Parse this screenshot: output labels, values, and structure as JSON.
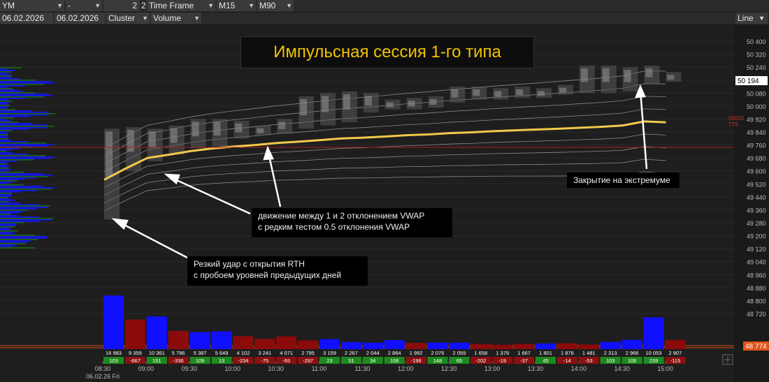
{
  "toolbar": {
    "symbol": "YM",
    "field2": "-",
    "field3": "2",
    "field3b": "2",
    "timeframe_label": "Time Frame",
    "tf1": "M15",
    "tf2": "M90",
    "date_from": "06.02.2026",
    "date_to": "06.02.2026",
    "chart_mode": "Cluster",
    "cluster_value": "Volume",
    "line_button": "Line"
  },
  "title": "Импульсная сессия 1-го типа",
  "callouts": {
    "extreme_close": "Закрытие на экстремуме",
    "vwap_line1": "движение между 1 и 2 отклонением VWAP",
    "vwap_line2": "с редким тестом 0.5 отклонения VWAP",
    "open_line1": "Резкий удар с открытия RTH",
    "open_line2": "с пробоем уровней предыдущих дней"
  },
  "price_badges": {
    "current_price": "50 194",
    "lower_price": "48 774",
    "mid_marker_top": "50000",
    "mid_marker_bottom": "779"
  },
  "colors": {
    "background": "#1c1c1c",
    "vwap": "#f2c94c",
    "buy": "#1010ff",
    "sell": "#8b0a0a",
    "delta_pos": "#1e8a1e",
    "delta_neg": "#8b1010",
    "title_text": "#f2c200",
    "current_badge": "#ffffff",
    "lower_badge": "#e0541a"
  },
  "chart_data": {
    "type": "bar",
    "title": "Импульсная сессия 1-го типа",
    "date_label": "06.02.26 Fri",
    "y_ticks": [
      "50 400",
      "50 320",
      "50 240",
      "50 160",
      "50 080",
      "50 000",
      "49 920",
      "49 840",
      "49 760",
      "49 680",
      "49 600",
      "49 520",
      "49 440",
      "49 360",
      "49 280",
      "49 200",
      "49 120",
      "49 040",
      "48 960",
      "48 880",
      "48 800",
      "48 720"
    ],
    "x_ticks": [
      "08:30",
      "09:00",
      "09:30",
      "10:00",
      "10:30",
      "11:00",
      "11:30",
      "12:00",
      "12:30",
      "13:00",
      "13:30",
      "14:00",
      "14:30",
      "15:00"
    ],
    "bars": {
      "volume": [
        16983,
        9359,
        10361,
        5786,
        5387,
        5649,
        4102,
        3241,
        4071,
        2795,
        3159,
        2267,
        2044,
        2864,
        1992,
        2076,
        2059,
        1658,
        1379,
        1667,
        1801,
        1876,
        1481,
        2313,
        2966,
        10053,
        2907
      ],
      "delta": [
        103,
        -667,
        151,
        -336,
        109,
        13,
        -234,
        -75,
        -93,
        -297,
        23,
        51,
        34,
        106,
        -198,
        148,
        65,
        -202,
        -19,
        -37,
        45,
        -14,
        -53,
        103,
        106,
        239,
        -115
      ]
    },
    "vwap": [
      49545,
      49615,
      49680,
      49700,
      49722,
      49738,
      49750,
      49760,
      49772,
      49780,
      49790,
      49800,
      49805,
      49812,
      49820,
      49825,
      49833,
      49838,
      49845,
      49850,
      49855,
      49860,
      49866,
      49872,
      49880,
      49905,
      49900
    ],
    "candles": [
      {
        "h": 49860,
        "l": 49300
      },
      {
        "h": 49870,
        "l": 49600
      },
      {
        "h": 49860,
        "l": 49660
      },
      {
        "h": 49880,
        "l": 49700
      },
      {
        "h": 49920,
        "l": 49740
      },
      {
        "h": 49920,
        "l": 49750
      },
      {
        "h": 49910,
        "l": 49800
      },
      {
        "h": 49880,
        "l": 49820
      },
      {
        "h": 49920,
        "l": 49830
      },
      {
        "h": 50060,
        "l": 49860
      },
      {
        "h": 50080,
        "l": 49880
      },
      {
        "h": 50090,
        "l": 49900
      },
      {
        "h": 50080,
        "l": 49960
      },
      {
        "h": 50040,
        "l": 49980
      },
      {
        "h": 50050,
        "l": 49980
      },
      {
        "h": 50060,
        "l": 49990
      },
      {
        "h": 50120,
        "l": 50020
      },
      {
        "h": 50120,
        "l": 50040
      },
      {
        "h": 50110,
        "l": 50040
      },
      {
        "h": 50120,
        "l": 50050
      },
      {
        "h": 50110,
        "l": 50050
      },
      {
        "h": 50130,
        "l": 50070
      },
      {
        "h": 50250,
        "l": 50080
      },
      {
        "h": 50250,
        "l": 50080
      },
      {
        "h": 50240,
        "l": 50090
      },
      {
        "h": 50250,
        "l": 50140
      },
      {
        "h": 50210,
        "l": 50150
      }
    ]
  }
}
